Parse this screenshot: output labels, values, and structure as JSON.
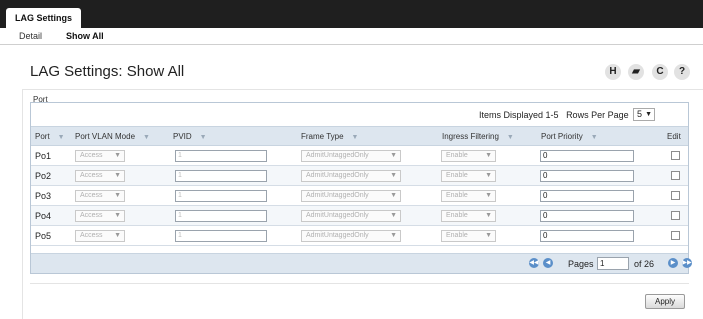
{
  "top_tab": "LAG Settings",
  "subnav": {
    "detail": "Detail",
    "show_all": "Show All"
  },
  "page_title": "LAG Settings: Show All",
  "toolbar_icons": {
    "help_icon_glyph": "H",
    "print_icon_glyph": "▰",
    "refresh_icon_glyph": "C",
    "question_icon_glyph": "?"
  },
  "section_label": "Port",
  "table_info": {
    "items_displayed": "Items Displayed 1-5",
    "rows_per_page_label": "Rows Per Page",
    "rows_per_page_value": "5"
  },
  "columns": [
    "Port",
    "Port VLAN Mode",
    "PVID",
    "Frame Type",
    "Ingress Filtering",
    "Port Priority",
    "Edit"
  ],
  "rows": [
    {
      "port": "Po1",
      "vlan_mode": "Access",
      "pvid": "1",
      "frame_type": "AdmitUntaggedOnly",
      "ingress": "Enable",
      "priority": "0"
    },
    {
      "port": "Po2",
      "vlan_mode": "Access",
      "pvid": "1",
      "frame_type": "AdmitUntaggedOnly",
      "ingress": "Enable",
      "priority": "0"
    },
    {
      "port": "Po3",
      "vlan_mode": "Access",
      "pvid": "1",
      "frame_type": "AdmitUntaggedOnly",
      "ingress": "Enable",
      "priority": "0"
    },
    {
      "port": "Po4",
      "vlan_mode": "Access",
      "pvid": "1",
      "frame_type": "AdmitUntaggedOnly",
      "ingress": "Enable",
      "priority": "0"
    },
    {
      "port": "Po5",
      "vlan_mode": "Access",
      "pvid": "1",
      "frame_type": "AdmitUntaggedOnly",
      "ingress": "Enable",
      "priority": "0"
    }
  ],
  "pager": {
    "pages_label": "Pages",
    "current_page": "1",
    "of_label": "of 26"
  },
  "apply_label": "Apply",
  "colors": {
    "topbar": "#1f1f1f",
    "header_row": "#dde6ef",
    "pager_button": "#5b8fc9"
  }
}
